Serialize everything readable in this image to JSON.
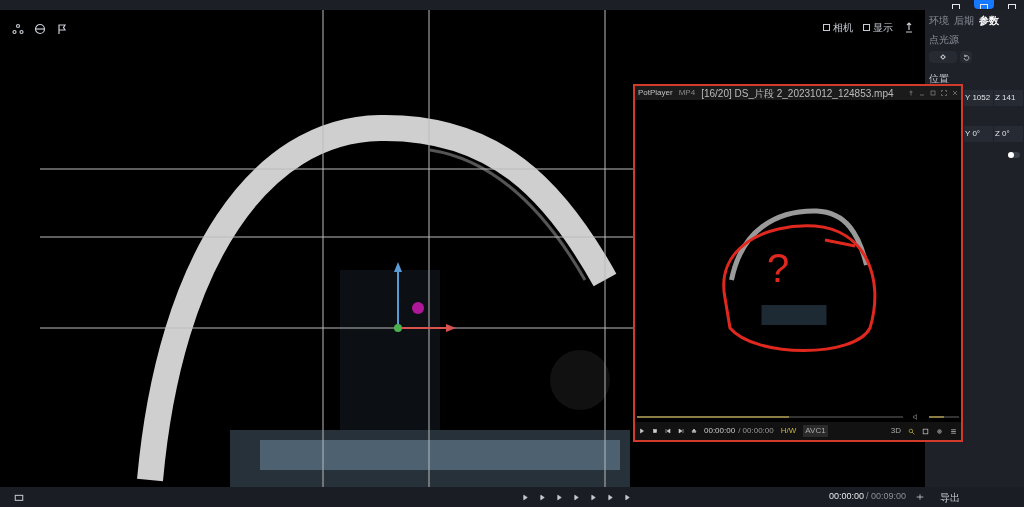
{
  "header_buttons": [
    {
      "selected": false
    },
    {
      "selected": true
    },
    {
      "selected": false
    }
  ],
  "viewport": {
    "toolbar_right": [
      "相机",
      "显示"
    ]
  },
  "panel": {
    "tabs": [
      {
        "label": "环境",
        "selected": false
      },
      {
        "label": "后期",
        "selected": false
      },
      {
        "label": "参数",
        "selected": true
      }
    ],
    "title": "点光源",
    "section": "位置",
    "position": [
      "Y 1052",
      "Z 141"
    ],
    "rotation": [
      "Y 0°",
      "Z 0°"
    ],
    "toggle": {
      "on": false
    }
  },
  "player": {
    "app": "PotPlayer",
    "format": "MP4",
    "file": "[16/20] DS_片段 2_20231012_124853.mp4",
    "annotation": "?",
    "seek": {
      "level": 0.57
    },
    "volume": {
      "level": 0.5
    },
    "time": "00:00:00",
    "duration": "/ 00:00:00",
    "decoder": "H/W",
    "codec": "AVC1",
    "mode": "3D"
  },
  "bottom_bar": {
    "time": "00:00:00",
    "duration": "/ 00:09:00",
    "export": "导出"
  }
}
